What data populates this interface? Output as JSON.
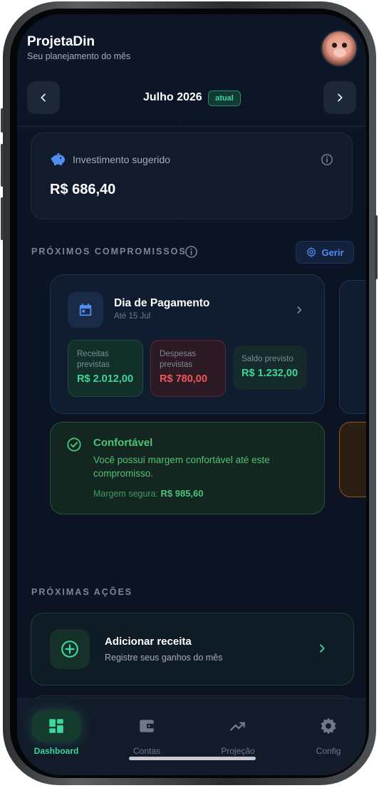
{
  "header": {
    "title": "ProjetaDin",
    "subtitle": "Seu planejamento do mês",
    "month": "Julho 2026",
    "badge": "atual"
  },
  "investment": {
    "label": "Investimento sugerido",
    "value": "R$ 686,40"
  },
  "commitments": {
    "section_title": "PRÓXIMOS COMPROMISSOS",
    "manage_label": "Gerir",
    "card": {
      "title": "Dia de Pagamento",
      "subtitle": "Até 15 Jul",
      "receitas_label": "Receitas previstas",
      "receitas_value": "R$ 2.012,00",
      "despesas_label": "Despesas previstas",
      "despesas_value": "R$ 780,00",
      "saldo_label": "Saldo previsto",
      "saldo_value": "R$ 1.232,00"
    },
    "status": {
      "title": "Confortável",
      "message": "Você possui margem confortável até este compromisso.",
      "margin_label": "Margem segura:",
      "margin_value": "R$ 985,60"
    }
  },
  "actions": {
    "section_title": "PRÓXIMAS AÇÕES",
    "items": [
      {
        "title": "Adicionar receita",
        "subtitle": "Registre seus ganhos do mês",
        "icon": "plus-circle-icon"
      }
    ]
  },
  "tabbar": {
    "tabs": [
      {
        "label": "Dashboard",
        "icon": "dashboard-icon",
        "active": true
      },
      {
        "label": "Contas",
        "icon": "wallet-icon",
        "active": false
      },
      {
        "label": "Projeção",
        "icon": "trending-up-icon",
        "active": false
      },
      {
        "label": "Config",
        "icon": "gear-icon",
        "active": false
      }
    ]
  },
  "colors": {
    "accent_green": "#3fd59b",
    "accent_blue": "#4f8df1",
    "danger_red": "#f0575c",
    "background": "#0b1424"
  }
}
